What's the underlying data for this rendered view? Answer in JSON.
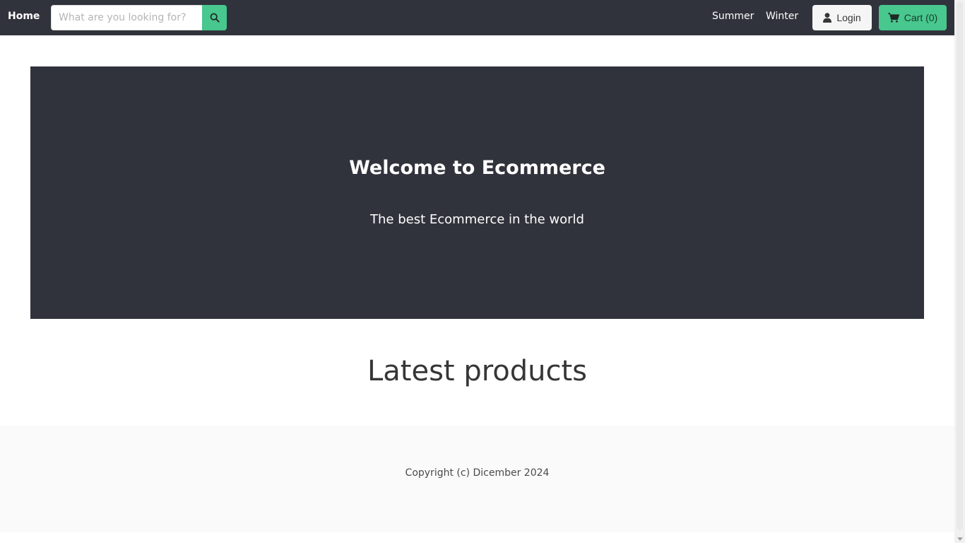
{
  "navbar": {
    "brand": "Home",
    "search": {
      "placeholder": "What are you looking for?",
      "value": ""
    },
    "links": [
      "Summer",
      "Winter"
    ],
    "login_label": "Login",
    "cart_label": "Cart (0)",
    "colors": {
      "background": "#31333c",
      "accent": "#48c78e"
    },
    "icons": {
      "search": "search-icon",
      "login": "user-icon",
      "cart": "shopping-cart-icon"
    }
  },
  "hero": {
    "title": "Welcome to Ecommerce",
    "subtitle": "The best Ecommerce in the world"
  },
  "main": {
    "section_title": "Latest products"
  },
  "footer": {
    "text": "Copyright (c) Dicember 2024"
  }
}
